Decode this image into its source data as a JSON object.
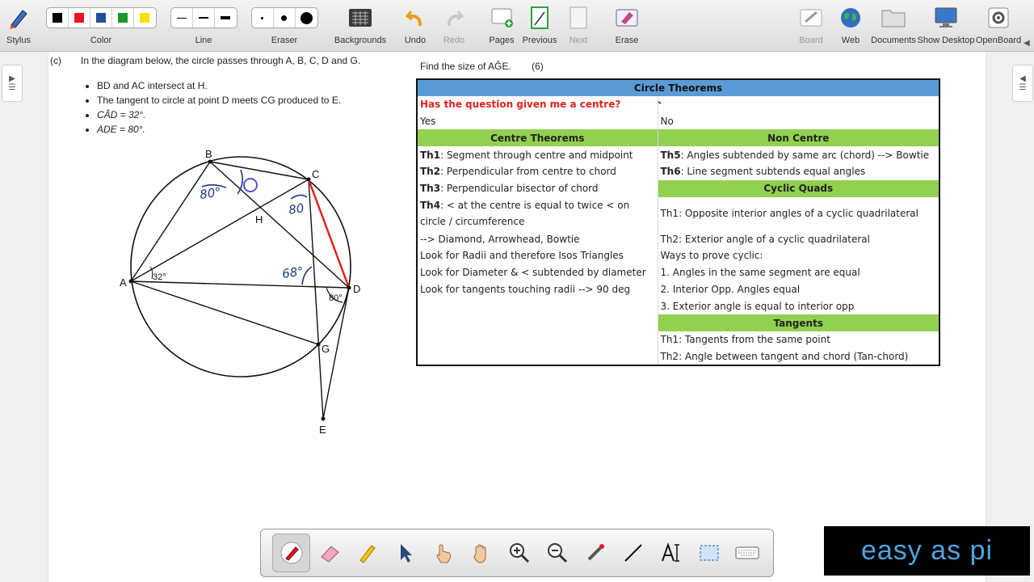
{
  "toolbar": {
    "stylus": "Stylus",
    "color": "Color",
    "line": "Line",
    "eraser": "Eraser",
    "backgrounds": "Backgrounds",
    "undo": "Undo",
    "redo": "Redo",
    "pages": "Pages",
    "previous": "Previous",
    "next": "Next",
    "erase": "Erase",
    "board": "Board",
    "web": "Web",
    "documents": "Documents",
    "show_desktop": "Show Desktop",
    "openboard": "OpenBoard",
    "colors": [
      "#000000",
      "#e8141e",
      "#1f4e9c",
      "#1a9a2a",
      "#f2e200"
    ]
  },
  "question": {
    "part": "(c)",
    "intro": "In the diagram below, the circle passes through A, B, C, D and G.",
    "bullets": [
      "BD and AC intersect at H.",
      "The tangent to circle at point D meets CG produced to E.",
      "CÂD = 32°.",
      "ADE = 80°."
    ],
    "ask": "Find the size of AĜE.",
    "marks": "(6)"
  },
  "diagram": {
    "points": {
      "A": "A",
      "B": "B",
      "C": "C",
      "D": "D",
      "G": "G",
      "E": "E",
      "H": "H"
    },
    "angle_a": "32°",
    "angle_d": "80°",
    "ink_b": "80°",
    "ink_c": "80",
    "ink_mid": "68°"
  },
  "table": {
    "title": "Circle Theorems",
    "question_row": "Has the question given me a centre?",
    "yes": "Yes",
    "no": "No",
    "centre_head": "Centre Theorems",
    "noncentre_head": "Non Centre",
    "th1": "Th1",
    "th1_text": ": Segment through centre and midpoint",
    "th5": "Th5",
    "th5_text": ": Angles subtended by same arc (chord) --> Bowtie",
    "th2": "Th2",
    "th2_text": ": Perpendicular from centre to chord",
    "th6": "Th6",
    "th6_text": ": Line segment subtends equal angles",
    "th3": "Th3",
    "th3_text": ": Perpendicular bisector of chord",
    "cyclic_head": "Cyclic Quads",
    "th4": "Th4",
    "th4_text": ": < at the centre is equal to twice < on circle / circumference",
    "cq1": "Th1: Opposite interior angles of a cyclic quadrilateral",
    "th4_note": "--> Diamond, Arrowhead, Bowtie",
    "cq2": "Th2: Exterior angle of a cyclic quadrilateral",
    "radii": "Look for Radii and therefore Isos Triangles",
    "prove": "Ways to prove cyclic:",
    "diameter": "Look for Diameter & < subtended by diameter",
    "p1": "1. Angles in the same segment are equal",
    "tangents_look": "Look for tangents touching radii --> 90 deg",
    "p2": "2. Interior Opp. Angles equal",
    "p3": "3. Exterior angle is equal to interior opp",
    "tangents_head": "Tangents",
    "t1": "Th1:  Tangents from the same point",
    "t2": "Th2: Angle between tangent and chord (Tan-chord)"
  },
  "logo": "easy as pi"
}
